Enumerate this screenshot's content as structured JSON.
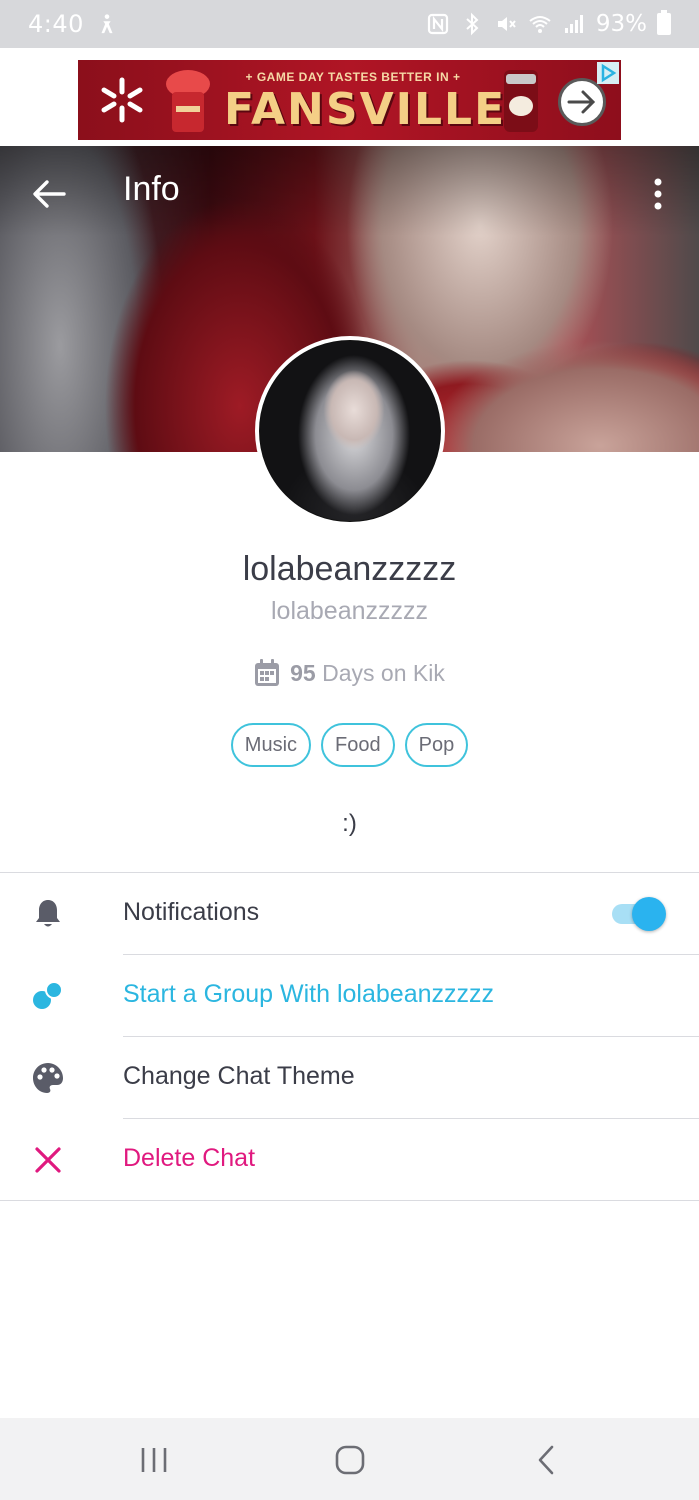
{
  "status_bar": {
    "time": "4:40",
    "battery": "93%",
    "icons": [
      "accessibility-icon",
      "nfc-icon",
      "bluetooth-icon",
      "mute-icon",
      "wifi-icon",
      "signal-icon",
      "battery-icon"
    ]
  },
  "ad": {
    "tagline": "+ GAME DAY TASTES BETTER IN +",
    "brand": "FANSVILLE",
    "icons": [
      "walmart-spark-icon",
      "dr-pepper-can-icon",
      "arrow-right-icon",
      "ad-choices-icon"
    ]
  },
  "header": {
    "title": "Info",
    "icons": [
      "back-arrow-icon",
      "more-vertical-icon"
    ]
  },
  "profile": {
    "display_name": "lolabeanzzzzz",
    "username": "lolabeanzzzzz",
    "days_count": "95",
    "days_label": "Days on Kik",
    "tags": [
      "Music",
      "Food",
      "Pop"
    ],
    "bio": ":)"
  },
  "settings": {
    "notifications": {
      "label": "Notifications",
      "enabled": true
    },
    "start_group": {
      "label": "Start a Group With lolabeanzzzzz"
    },
    "chat_theme": {
      "label": "Change Chat Theme"
    },
    "delete_chat": {
      "label": "Delete Chat"
    }
  },
  "colors": {
    "accent_blue": "#2bb6e0",
    "danger_pink": "#e0197f",
    "tag_border": "#3fc3dc"
  },
  "navbar": {
    "icons": [
      "recent-apps-icon",
      "home-icon",
      "back-icon"
    ]
  }
}
